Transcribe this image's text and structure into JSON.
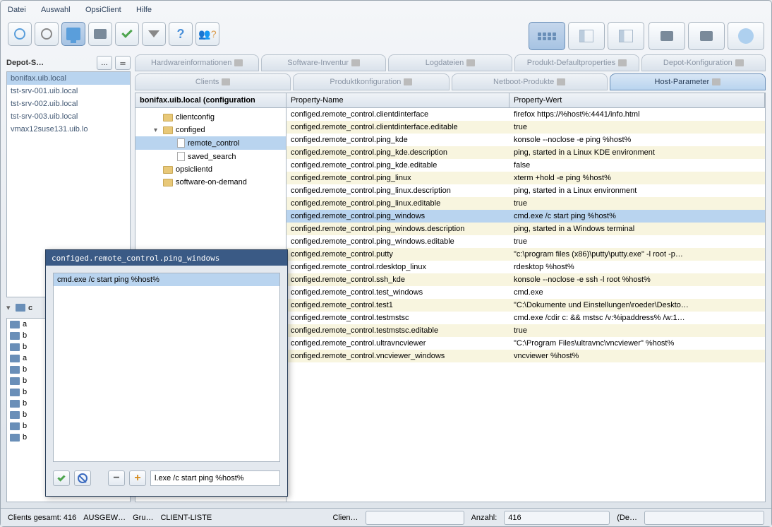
{
  "menu": {
    "datei": "Datei",
    "auswahl": "Auswahl",
    "opsiclient": "OpsiClient",
    "hilfe": "Hilfe"
  },
  "depot": {
    "title": "Depot-S…",
    "btn1": "…",
    "btn2": "＝",
    "items": [
      "bonifax.uib.local",
      "tst-srv-001.uib.local",
      "tst-srv-002.uib.local",
      "tst-srv-003.uib.local",
      "vmax12suse131.uib.lo"
    ],
    "selected": 0
  },
  "clientSection": {
    "header": "c",
    "items": [
      "a",
      "b",
      "b",
      "a",
      "b",
      "b",
      "b",
      "b",
      "b",
      "b",
      "b"
    ]
  },
  "tabsRow1": [
    "Hardwareinformationen",
    "Software-Inventur",
    "Logdateien",
    "Produkt-Defaultproperties",
    "Depot-Konfiguration"
  ],
  "tabsRow2": [
    "Clients",
    "Produktkonfiguration",
    "Netboot-Produkte",
    "Host-Parameter"
  ],
  "activeTab": "Host-Parameter",
  "tree": {
    "header": "bonifax.uib.local (configuration",
    "items": [
      {
        "level": 1,
        "toggle": "",
        "icon": "folder",
        "label": "clientconfig"
      },
      {
        "level": 1,
        "toggle": "▾",
        "icon": "folder",
        "label": "configed"
      },
      {
        "level": 2,
        "toggle": "",
        "icon": "file",
        "label": "remote_control",
        "selected": true
      },
      {
        "level": 2,
        "toggle": "",
        "icon": "file",
        "label": "saved_search"
      },
      {
        "level": 1,
        "toggle": "",
        "icon": "folder",
        "label": "opsiclientd"
      },
      {
        "level": 1,
        "toggle": "",
        "icon": "folder",
        "label": "software-on-demand"
      }
    ]
  },
  "propTable": {
    "header": {
      "name": "Property-Name",
      "wert": "Property-Wert"
    },
    "rows": [
      {
        "name": "configed.remote_control.clientdinterface",
        "wert": "firefox https://%host%:4441/info.html"
      },
      {
        "name": "configed.remote_control.clientdinterface.editable",
        "wert": "true"
      },
      {
        "name": "configed.remote_control.ping_kde",
        "wert": "konsole --noclose -e ping %host%"
      },
      {
        "name": "configed.remote_control.ping_kde.description",
        "wert": "ping, started in a Linux KDE environment"
      },
      {
        "name": "configed.remote_control.ping_kde.editable",
        "wert": "false"
      },
      {
        "name": "configed.remote_control.ping_linux",
        "wert": "xterm +hold -e ping %host%"
      },
      {
        "name": "configed.remote_control.ping_linux.description",
        "wert": "ping, started in a Linux environment"
      },
      {
        "name": "configed.remote_control.ping_linux.editable",
        "wert": "true"
      },
      {
        "name": "configed.remote_control.ping_windows",
        "wert": "cmd.exe /c start ping %host%",
        "selected": true
      },
      {
        "name": "configed.remote_control.ping_windows.description",
        "wert": "ping, started in a Windows terminal"
      },
      {
        "name": "configed.remote_control.ping_windows.editable",
        "wert": "true"
      },
      {
        "name": "configed.remote_control.putty",
        "wert": "\"c:\\program files (x86)\\putty\\putty.exe\" -l root -p…"
      },
      {
        "name": "configed.remote_control.rdesktop_linux",
        "wert": "rdesktop %host%"
      },
      {
        "name": "configed.remote_control.ssh_kde",
        "wert": "konsole --noclose -e ssh -l root  %host%"
      },
      {
        "name": "configed.remote_control.test_windows",
        "wert": "cmd.exe"
      },
      {
        "name": "configed.remote_control.test1",
        "wert": "\"C:\\Dokumente und Einstellungen\\roeder\\Deskto…"
      },
      {
        "name": "configed.remote_control.testmstsc",
        "wert": "cmd.exe /cdir c: &&  mstsc /v:%ipaddress% /w:1…"
      },
      {
        "name": "configed.remote_control.testmstsc.editable",
        "wert": "true"
      },
      {
        "name": "configed.remote_control.ultravncviewer",
        "wert": "\"C:\\Program Files\\ultravnc\\vncviewer\" %host%"
      },
      {
        "name": "configed.remote_control.vncviewer_windows",
        "wert": "vncviewer %host%"
      }
    ]
  },
  "popup": {
    "title": "configed.remote_control.ping_windows",
    "listItem": "cmd.exe /c start ping %host%",
    "input": "l.exe /c start ping %host%"
  },
  "status": {
    "clientsGesamt": "Clients gesamt:  416",
    "ausgew": "AUSGEW…",
    "gru": "Gru…",
    "clientListe": "CLIENT-LISTE",
    "clien": "Clien…",
    "anzahl": "Anzahl:",
    "anzahlVal": "416",
    "de": "(De…"
  }
}
